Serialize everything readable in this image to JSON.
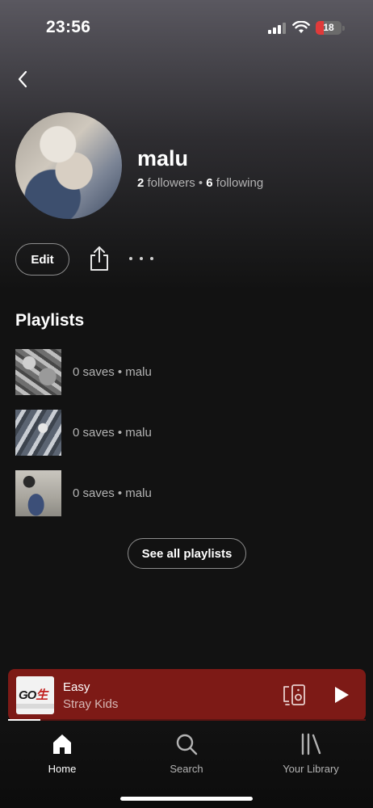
{
  "status_bar": {
    "time": "23:56",
    "battery_level": "18",
    "battery_color": "#e03a3a"
  },
  "profile": {
    "name": "malu",
    "followers_count": "2",
    "followers_label": " followers",
    "separator": " • ",
    "following_count": "6",
    "following_label": " following"
  },
  "actions": {
    "edit_label": "Edit"
  },
  "playlists": {
    "title": "Playlists",
    "items": [
      {
        "meta": "0 saves • malu"
      },
      {
        "meta": "0 saves • malu"
      },
      {
        "meta": "0 saves • malu"
      }
    ],
    "see_all_label": "See all playlists"
  },
  "now_playing": {
    "title": "Easy",
    "artist": "Stray Kids",
    "progress": 0.09,
    "background": "#7d1a16",
    "art_logo": "GO",
    "art_logo_accent": "生"
  },
  "nav": {
    "items": [
      {
        "label": "Home",
        "icon": "home-icon",
        "active": true
      },
      {
        "label": "Search",
        "icon": "search-icon",
        "active": false
      },
      {
        "label": "Your Library",
        "icon": "library-icon",
        "active": false
      }
    ]
  },
  "colors": {
    "accent_text": "#b3b3b3",
    "background": "#121212"
  }
}
